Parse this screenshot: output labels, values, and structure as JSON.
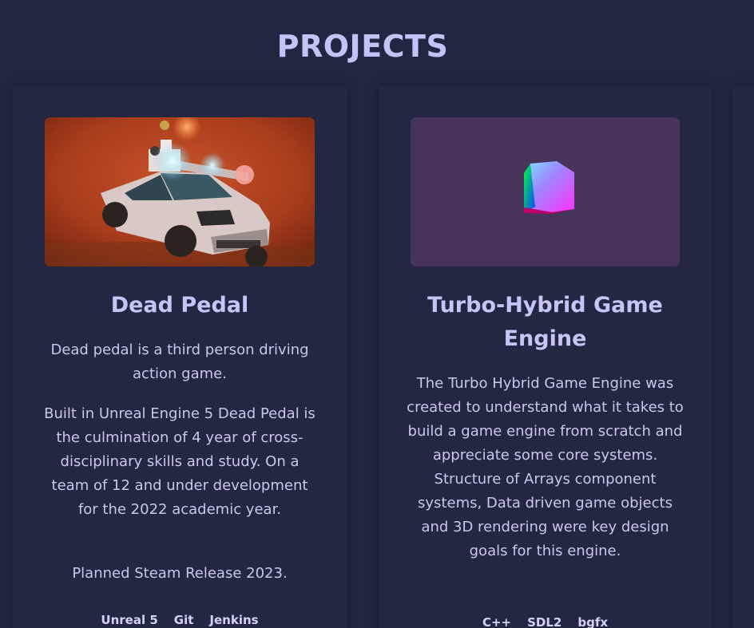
{
  "section": {
    "title": "PROJECTS"
  },
  "projects": [
    {
      "title": "Dead Pedal",
      "paragraphs": [
        "Dead pedal is a third person driving action game.",
        "Built in Unreal Engine 5 Dead Pedal is the culmination of 4 year of cross-disciplinary skills and study. On a team of 12 and under development for the 2022 academic year.",
        "Planned Steam Release 2023."
      ],
      "tags": [
        "Unreal 5",
        "Git",
        "Jenkins"
      ]
    },
    {
      "title": "Turbo-Hybrid Game Engine",
      "paragraphs": [
        "The Turbo Hybrid Game Engine was created to understand what it takes to build a game engine from scratch and appreciate some core systems. Structure of Arrays component systems, Data driven game objects and 3D rendering were key design goals for this engine."
      ],
      "tags": [
        "C++",
        "SDL2",
        "bgfx"
      ]
    }
  ],
  "colors": {
    "background": "#222640",
    "title": "#c4c3f7",
    "thumb_purple": "#46345a"
  }
}
